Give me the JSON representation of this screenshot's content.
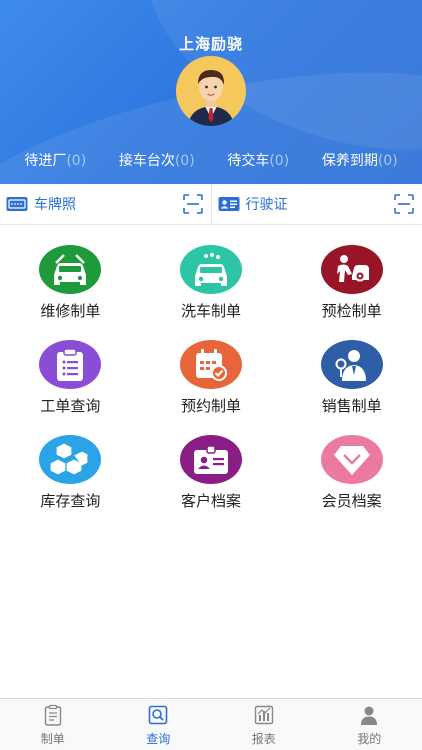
{
  "header": {
    "shop_name": "上海励骁",
    "stats": [
      {
        "label": "待进厂",
        "count": "(0)"
      },
      {
        "label": "接车台次",
        "count": "(0)"
      },
      {
        "label": "待交车",
        "count": "(0)"
      },
      {
        "label": "保养到期",
        "count": "(0)"
      }
    ]
  },
  "scan": {
    "plate_label": "车牌照",
    "license_label": "行驶证"
  },
  "grid": [
    {
      "label": "维修制单",
      "icon": "car-repair-icon",
      "color": "#1f9a3a"
    },
    {
      "label": "洗车制单",
      "icon": "car-wash-icon",
      "color": "#2ec4a6"
    },
    {
      "label": "预检制单",
      "icon": "pre-inspection-icon",
      "color": "#9a1427"
    },
    {
      "label": "工单查询",
      "icon": "clipboard-icon",
      "color": "#8a4dd6"
    },
    {
      "label": "预约制单",
      "icon": "calendar-check-icon",
      "color": "#e8643a"
    },
    {
      "label": "销售制单",
      "icon": "salesperson-icon",
      "color": "#2f5ea8"
    },
    {
      "label": "库存查询",
      "icon": "boxes-icon",
      "color": "#2aa4e6"
    },
    {
      "label": "客户档案",
      "icon": "id-card-icon",
      "color": "#8b1e86"
    },
    {
      "label": "会员档案",
      "icon": "diamond-icon",
      "color": "#ec7aa0"
    }
  ],
  "tabs": [
    {
      "label": "制单",
      "icon": "clipboard-icon",
      "active": false
    },
    {
      "label": "查询",
      "icon": "search-doc-icon",
      "active": true
    },
    {
      "label": "报表",
      "icon": "bar-chart-icon",
      "active": false
    },
    {
      "label": "我的",
      "icon": "user-icon",
      "active": false
    }
  ],
  "colors": {
    "primary": "#2b6fd6",
    "header_bg": "#3f8bea"
  }
}
